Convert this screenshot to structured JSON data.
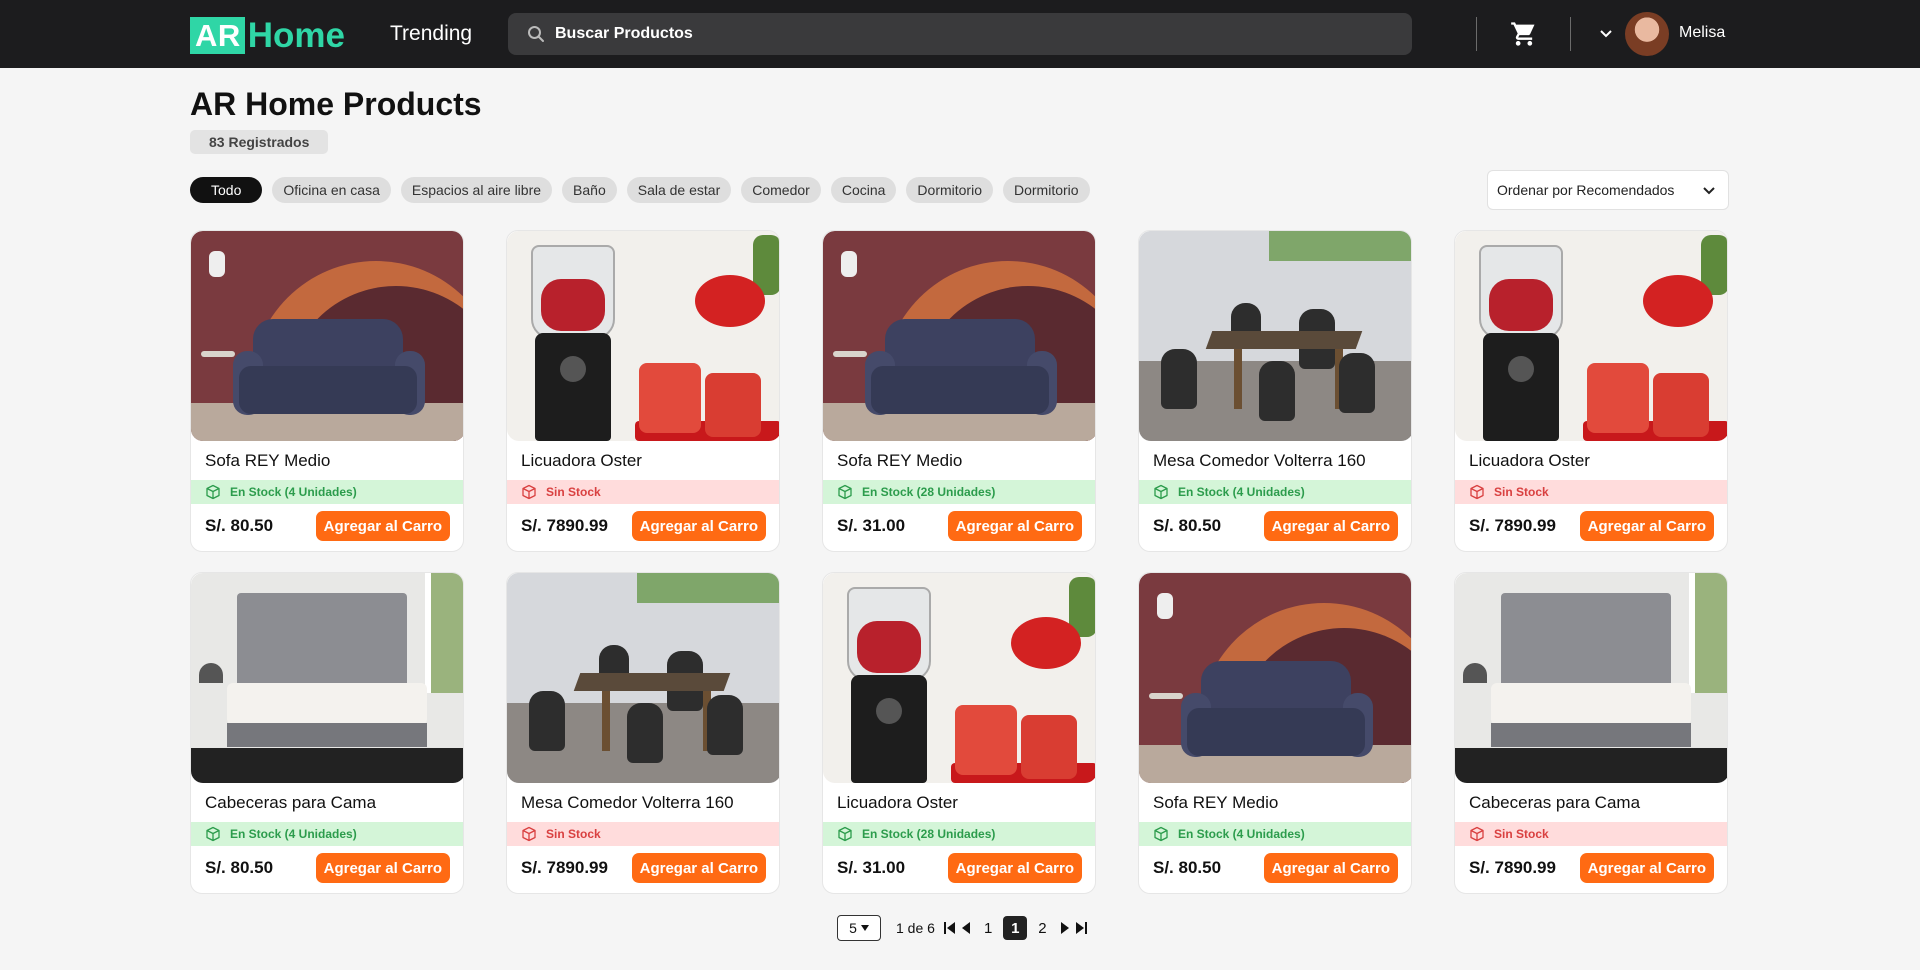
{
  "header": {
    "logo_ar": "AR",
    "logo_home": "Home",
    "trending_label": "Trending",
    "search_placeholder": "Buscar Productos",
    "username": "Melisa"
  },
  "page": {
    "title": "AR Home Products",
    "count_label": "83 Registrados"
  },
  "filters": [
    {
      "label": "Todo",
      "active": true
    },
    {
      "label": "Oficina en casa"
    },
    {
      "label": "Espacios al aire libre"
    },
    {
      "label": "Baño"
    },
    {
      "label": "Sala de estar"
    },
    {
      "label": "Comedor"
    },
    {
      "label": "Cocina"
    },
    {
      "label": "Dormitorio"
    },
    {
      "label": "Dormitorio"
    }
  ],
  "sort": {
    "label": "Ordenar por Recomendados"
  },
  "add_label": "Agregar al Carro",
  "products": [
    {
      "name": "Sofa REY Medio",
      "stock": "En Stock (4 Unidades)",
      "in_stock": true,
      "price": "S/. 80.50",
      "image": "sofa"
    },
    {
      "name": "Licuadora Oster",
      "stock": "Sin Stock",
      "in_stock": false,
      "price": "S/. 7890.99",
      "image": "blender"
    },
    {
      "name": "Sofa REY Medio",
      "stock": "En Stock (28 Unidades)",
      "in_stock": true,
      "price": "S/. 31.00",
      "image": "sofa"
    },
    {
      "name": "Mesa Comedor Volterra 160",
      "stock": "En Stock (4 Unidades)",
      "in_stock": true,
      "price": "S/. 80.50",
      "image": "dining"
    },
    {
      "name": "Licuadora Oster",
      "stock": "Sin Stock",
      "in_stock": false,
      "price": "S/. 7890.99",
      "image": "blender"
    },
    {
      "name": "Cabeceras para Cama",
      "stock": "En Stock (4 Unidades)",
      "in_stock": true,
      "price": "S/. 80.50",
      "image": "bed"
    },
    {
      "name": "Mesa Comedor Volterra 160",
      "stock": "Sin Stock",
      "in_stock": false,
      "price": "S/. 7890.99",
      "image": "dining"
    },
    {
      "name": "Licuadora Oster",
      "stock": "En Stock (28 Unidades)",
      "in_stock": true,
      "price": "S/. 31.00",
      "image": "blender"
    },
    {
      "name": "Sofa REY Medio",
      "stock": "En Stock (4 Unidades)",
      "in_stock": true,
      "price": "S/. 80.50",
      "image": "sofa"
    },
    {
      "name": "Cabeceras para Cama",
      "stock": "Sin Stock",
      "in_stock": false,
      "price": "S/. 7890.99",
      "image": "bed"
    }
  ],
  "pagination": {
    "per_page": "5",
    "info": "1 de 6",
    "current_page": "1",
    "pages": [
      "1",
      "2"
    ]
  },
  "colors": {
    "accent": "#2fd6a6",
    "button": "#ff6a13",
    "in_stock_bg": "#d4f5d8",
    "out_stock_bg": "#ffdcdc"
  }
}
